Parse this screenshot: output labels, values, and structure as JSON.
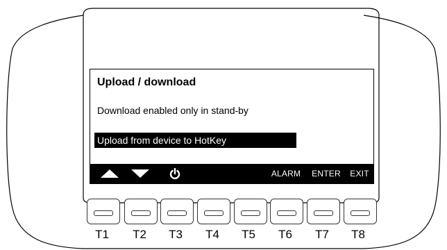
{
  "screen": {
    "title": "Upload / download",
    "message": "Download enabled only in stand-by",
    "selected_item": "Upload from device to HotKey"
  },
  "softkeys": [
    {
      "icon": "up-arrow-icon",
      "label": ""
    },
    {
      "icon": "down-arrow-icon",
      "label": ""
    },
    {
      "icon": "power-icon",
      "label": ""
    },
    {
      "icon": "",
      "label": "ALARM"
    },
    {
      "icon": "",
      "label": "ENTER"
    },
    {
      "icon": "",
      "label": "EXIT"
    }
  ],
  "keys": [
    "T1",
    "T2",
    "T3",
    "T4",
    "T5",
    "T6",
    "T7",
    "T8"
  ],
  "colors": {
    "screen_bg": "#ffffff",
    "bar": "#000000",
    "text": "#000000",
    "inverse_text": "#ffffff"
  }
}
